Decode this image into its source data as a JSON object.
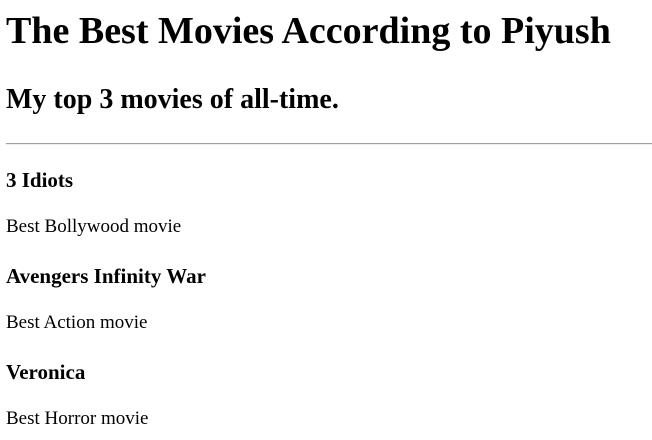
{
  "page": {
    "title": "The Best Movies According to Piyush",
    "subtitle": "My top 3 movies of all-time."
  },
  "movies": [
    {
      "title": "3 Idiots",
      "description": "Best Bollywood movie"
    },
    {
      "title": "Avengers Infinity War",
      "description": "Best Action movie"
    },
    {
      "title": "Veronica",
      "description": "Best Horror movie"
    }
  ]
}
